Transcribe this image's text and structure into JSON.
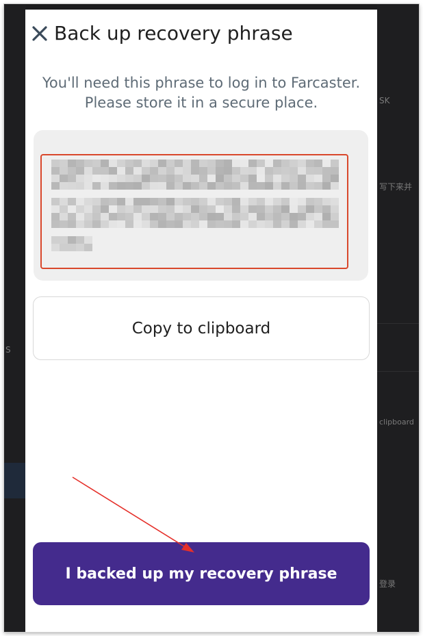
{
  "modal": {
    "title": "Back up recovery phrase",
    "subtitle_line1": "You'll need this phrase to log in to Farcaster.",
    "subtitle_line2": "Please store it in a secure place.",
    "phrase_state": "blurred",
    "copy_label": "Copy to clipboard",
    "confirm_label": "I backed up my recovery phrase"
  },
  "background": {
    "right_text_1": "SK",
    "right_text_2": "写下来并",
    "right_text_3": "clipboard",
    "right_text_4": "登录",
    "left_text": "S"
  },
  "colors": {
    "primary": "#442b8d",
    "highlight_border": "#d9472b",
    "annotation_arrow": "#e5302a"
  },
  "icons": {
    "close": "close-icon"
  }
}
